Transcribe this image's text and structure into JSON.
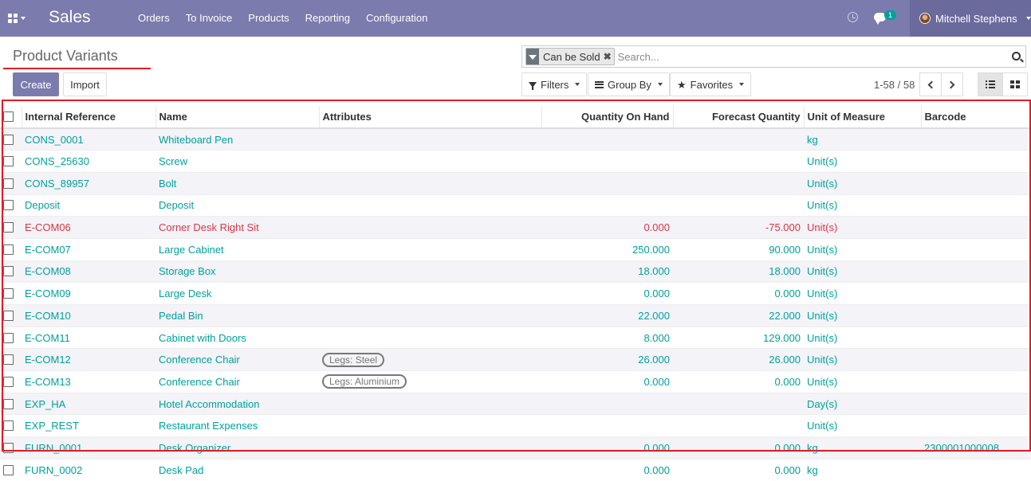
{
  "navbar": {
    "app_title": "Sales",
    "menu": [
      "Orders",
      "To Invoice",
      "Products",
      "Reporting",
      "Configuration"
    ],
    "chat_badge": "1",
    "user_name": "Mitchell Stephens"
  },
  "page": {
    "breadcrumb": "Product Variants",
    "search": {
      "facet_label": "Can be Sold",
      "placeholder": "Search..."
    },
    "create_label": "Create",
    "import_label": "Import",
    "filters_label": "Filters",
    "groupby_label": "Group By",
    "favorites_label": "Favorites",
    "pager": "1-58 / 58"
  },
  "table": {
    "columns": [
      "Internal Reference",
      "Name",
      "Attributes",
      "Quantity On Hand",
      "Forecast Quantity",
      "Unit of Measure",
      "Barcode"
    ],
    "rows": [
      {
        "ref": "CONS_0001",
        "name": "Whiteboard Pen",
        "attr": "",
        "qoh": "",
        "forecast": "",
        "uom": "kg",
        "barcode": ""
      },
      {
        "ref": "CONS_25630",
        "name": "Screw",
        "attr": "",
        "qoh": "",
        "forecast": "",
        "uom": "Unit(s)",
        "barcode": ""
      },
      {
        "ref": "CONS_89957",
        "name": "Bolt",
        "attr": "",
        "qoh": "",
        "forecast": "",
        "uom": "Unit(s)",
        "barcode": ""
      },
      {
        "ref": "Deposit",
        "name": "Deposit",
        "attr": "",
        "qoh": "",
        "forecast": "",
        "uom": "Unit(s)",
        "barcode": ""
      },
      {
        "ref": "E-COM06",
        "name": "Corner Desk Right Sit",
        "attr": "",
        "qoh": "0.000",
        "forecast": "-75.000",
        "uom": "Unit(s)",
        "barcode": "",
        "danger": true
      },
      {
        "ref": "E-COM07",
        "name": "Large Cabinet",
        "attr": "",
        "qoh": "250.000",
        "forecast": "90.000",
        "uom": "Unit(s)",
        "barcode": ""
      },
      {
        "ref": "E-COM08",
        "name": "Storage Box",
        "attr": "",
        "qoh": "18.000",
        "forecast": "18.000",
        "uom": "Unit(s)",
        "barcode": ""
      },
      {
        "ref": "E-COM09",
        "name": "Large Desk",
        "attr": "",
        "qoh": "0.000",
        "forecast": "0.000",
        "uom": "Unit(s)",
        "barcode": ""
      },
      {
        "ref": "E-COM10",
        "name": "Pedal Bin",
        "attr": "",
        "qoh": "22.000",
        "forecast": "22.000",
        "uom": "Unit(s)",
        "barcode": ""
      },
      {
        "ref": "E-COM11",
        "name": "Cabinet with Doors",
        "attr": "",
        "qoh": "8.000",
        "forecast": "129.000",
        "uom": "Unit(s)",
        "barcode": ""
      },
      {
        "ref": "E-COM12",
        "name": "Conference Chair",
        "attr": "Legs: Steel",
        "qoh": "26.000",
        "forecast": "26.000",
        "uom": "Unit(s)",
        "barcode": ""
      },
      {
        "ref": "E-COM13",
        "name": "Conference Chair",
        "attr": "Legs: Aluminium",
        "qoh": "0.000",
        "forecast": "0.000",
        "uom": "Unit(s)",
        "barcode": ""
      },
      {
        "ref": "EXP_HA",
        "name": "Hotel Accommodation",
        "attr": "",
        "qoh": "",
        "forecast": "",
        "uom": "Day(s)",
        "barcode": ""
      },
      {
        "ref": "EXP_REST",
        "name": "Restaurant Expenses",
        "attr": "",
        "qoh": "",
        "forecast": "",
        "uom": "Unit(s)",
        "barcode": ""
      },
      {
        "ref": "FURN_0001",
        "name": "Desk Organizer",
        "attr": "",
        "qoh": "0.000",
        "forecast": "0.000",
        "uom": "kg",
        "barcode": "2300001000008"
      },
      {
        "ref": "FURN_0002",
        "name": "Desk Pad",
        "attr": "",
        "qoh": "0.000",
        "forecast": "0.000",
        "uom": "kg",
        "barcode": ""
      }
    ]
  }
}
